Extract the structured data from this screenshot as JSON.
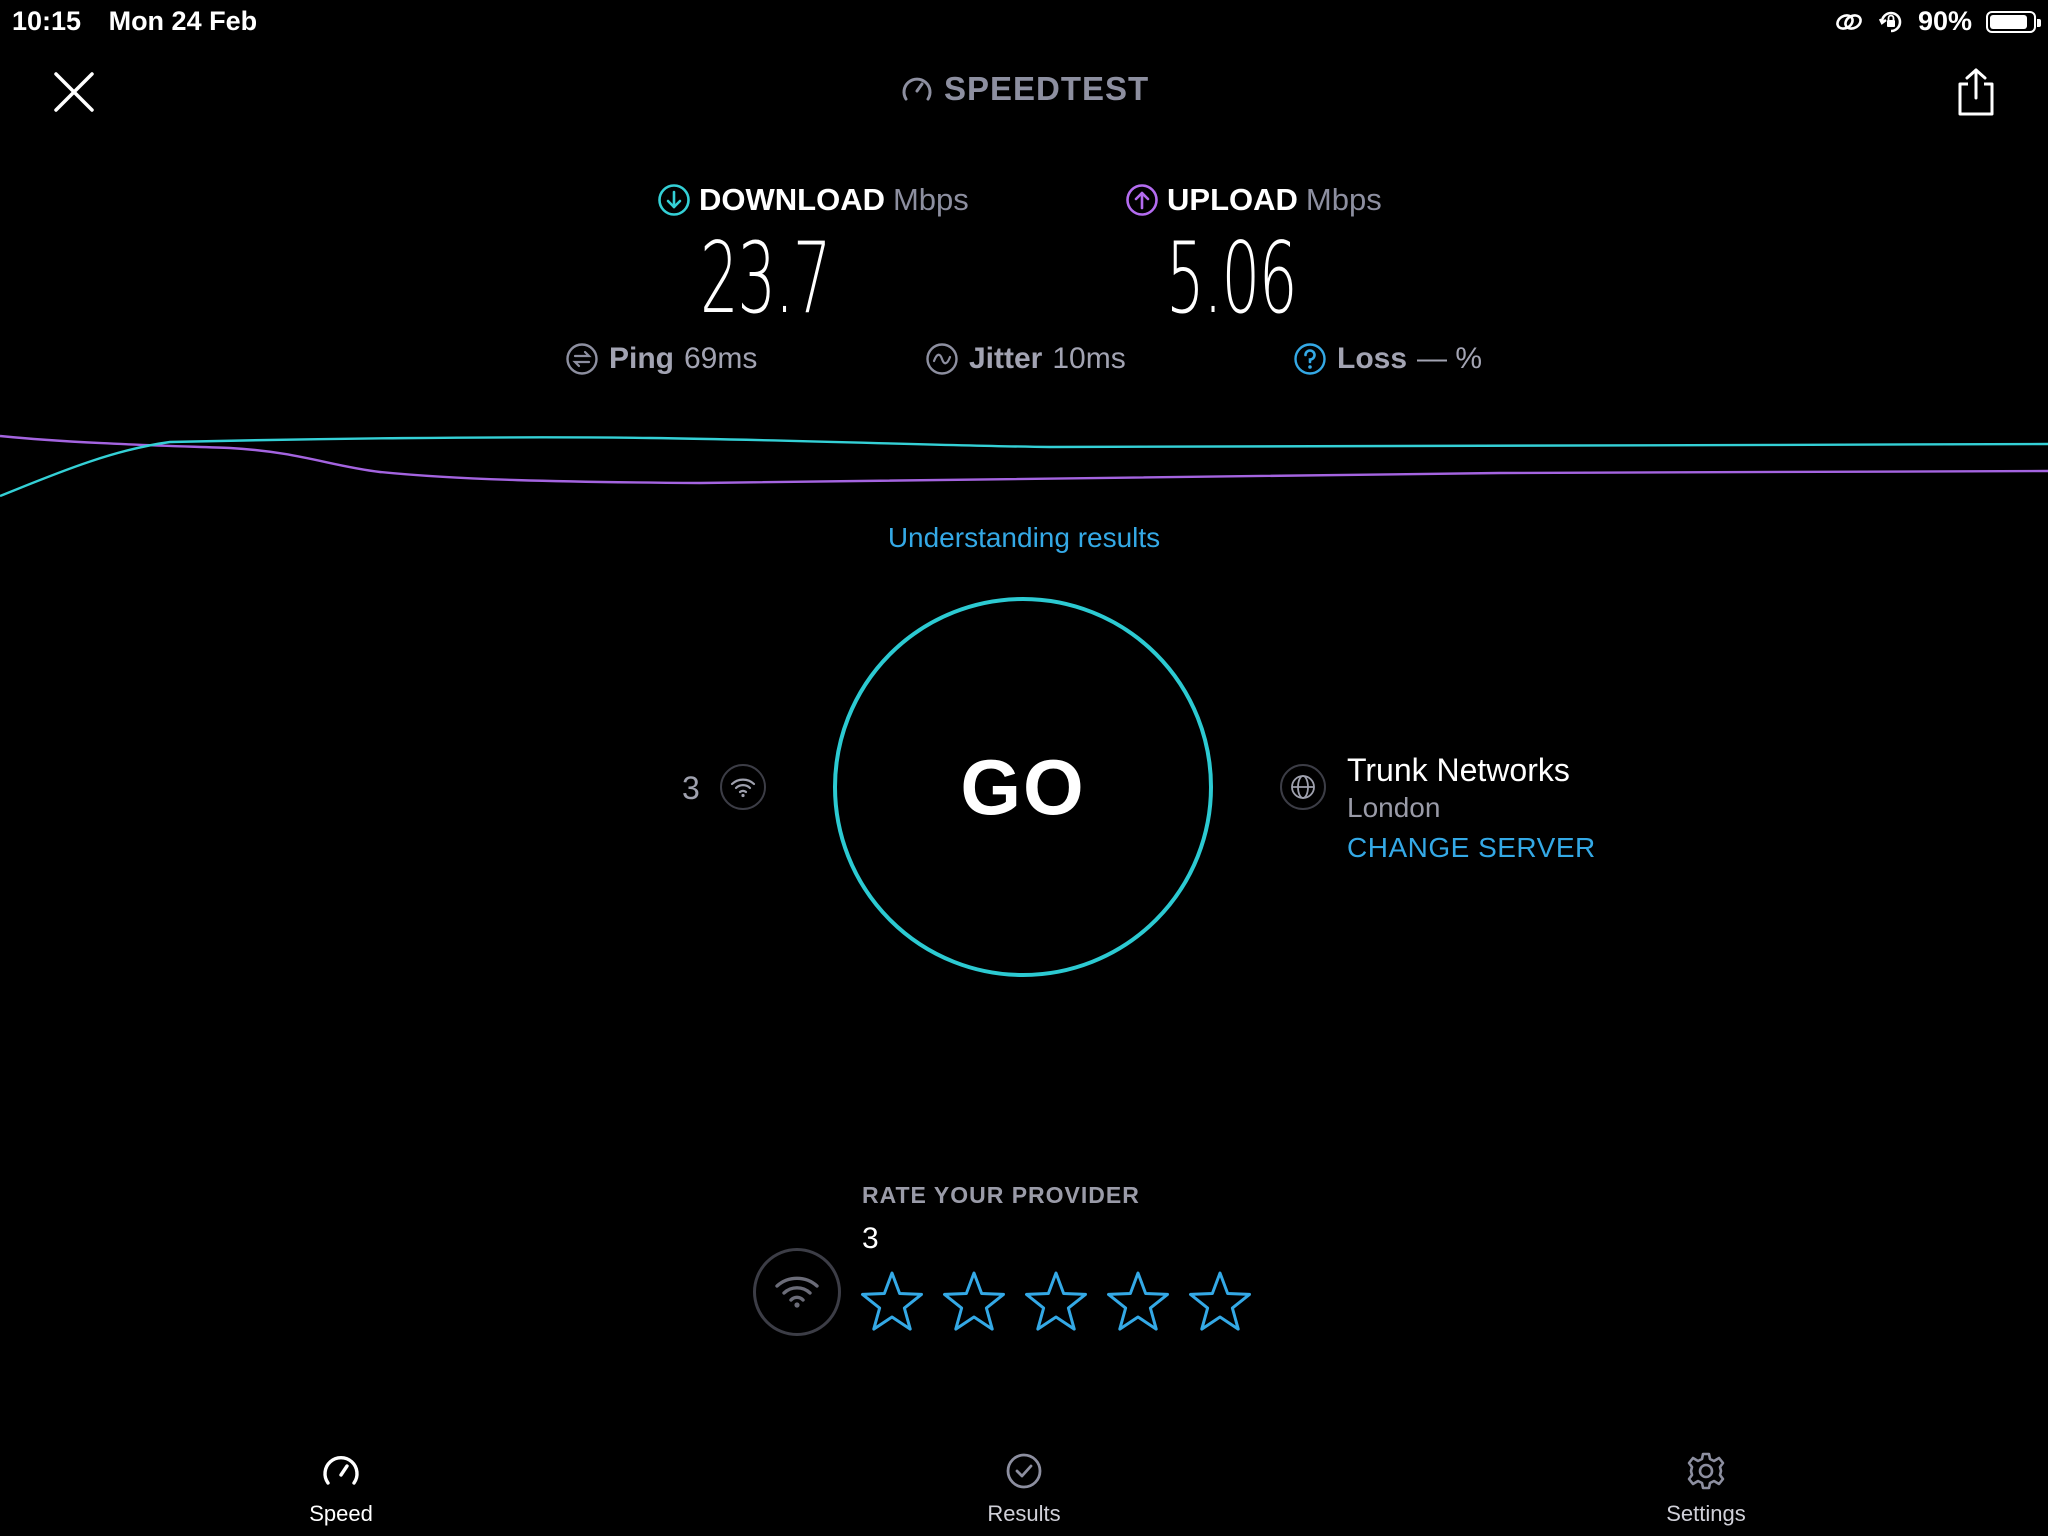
{
  "status_bar": {
    "time": "10:15",
    "date": "Mon 24 Feb",
    "battery": "90%",
    "battery_level": 0.9
  },
  "header": {
    "brand": "SPEEDTEST"
  },
  "metrics": {
    "download": {
      "label": "DOWNLOAD",
      "unit": "Mbps",
      "value": "23.7",
      "color": "#34d0d6"
    },
    "upload": {
      "label": "UPLOAD",
      "unit": "Mbps",
      "value": "5.06",
      "color": "#b46cf0"
    },
    "ping": {
      "label": "Ping",
      "value": "69ms"
    },
    "jitter": {
      "label": "Jitter",
      "value": "10ms"
    },
    "loss": {
      "label": "Loss",
      "value": "— %"
    }
  },
  "graph": {
    "download_color": "#34d0d6",
    "upload_color": "#a464e0"
  },
  "understanding_link": "Understanding results",
  "go_button": "GO",
  "connection": {
    "count": "3"
  },
  "server": {
    "name": "Trunk Networks",
    "location": "London",
    "change_label": "CHANGE SERVER"
  },
  "rating": {
    "title": "RATE YOUR PROVIDER",
    "provider": "3",
    "star_count": 5,
    "star_color": "#34a9e6"
  },
  "tabs": [
    {
      "label": "Speed",
      "icon": "speedometer-icon",
      "active": true
    },
    {
      "label": "Results",
      "icon": "check-circle-icon",
      "active": false
    },
    {
      "label": "Settings",
      "icon": "gear-icon",
      "active": false
    }
  ],
  "colors": {
    "accent": "#34a9e6",
    "go_ring": "#2ccad2",
    "muted_text": "#9a9ba8"
  }
}
